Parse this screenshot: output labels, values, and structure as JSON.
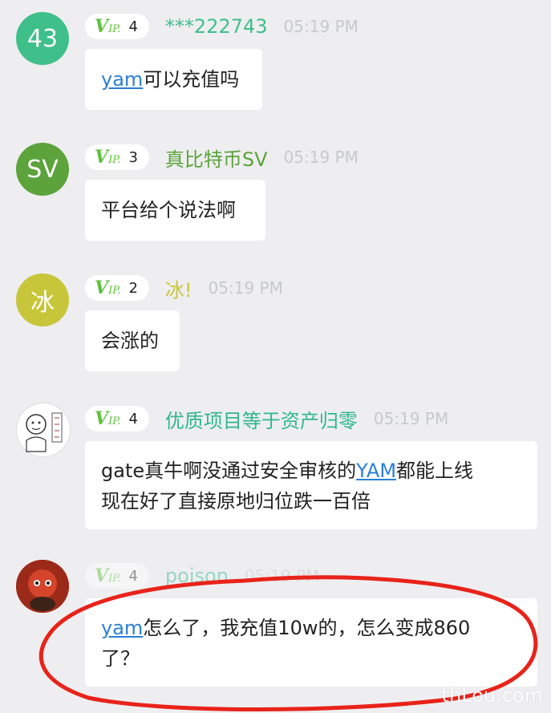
{
  "messages": [
    {
      "avatar_text": "43",
      "avatar_color": "#3fbf8a",
      "vip_level": "4",
      "username": "***222743",
      "name_color": "#3fbf8a",
      "time": "05:19 PM",
      "text_link": "yam",
      "text_rest": "可以充值吗"
    },
    {
      "avatar_text": "SV",
      "avatar_color": "#5ba33a",
      "vip_level": "3",
      "username": "真比特币SV",
      "name_color": "#5ba33a",
      "time": "05:19 PM",
      "text": "平台给个说法啊"
    },
    {
      "avatar_text": "冰",
      "avatar_color": "#c7c63a",
      "vip_level": "2",
      "username": "冰!",
      "name_color": "#c7c63a",
      "time": "05:19 PM",
      "text": "会涨的"
    },
    {
      "vip_level": "4",
      "username": "优质项目等于资产归零",
      "name_color": "#2fb88a",
      "time": "05:19 PM",
      "line1_pre": "gate真牛啊没通过安全审核的",
      "line1_link": "YAM",
      "line1_post": "都能上线",
      "line2": "现在好了直接原地归位跌一百倍"
    },
    {
      "vip_level": "4",
      "username": "poison",
      "name_color": "#2fb88a",
      "time": "05:19 PM",
      "line1_link": "yam",
      "line1_post": "怎么了，我充值10w的，怎么变成860",
      "line2": "了？"
    }
  ],
  "vip_prefix": "V",
  "vip_suffix": "IP.",
  "watermark": "thLou.com",
  "colors": {
    "annotation_circle": "#e8231a",
    "link": "#2b7fd6"
  }
}
